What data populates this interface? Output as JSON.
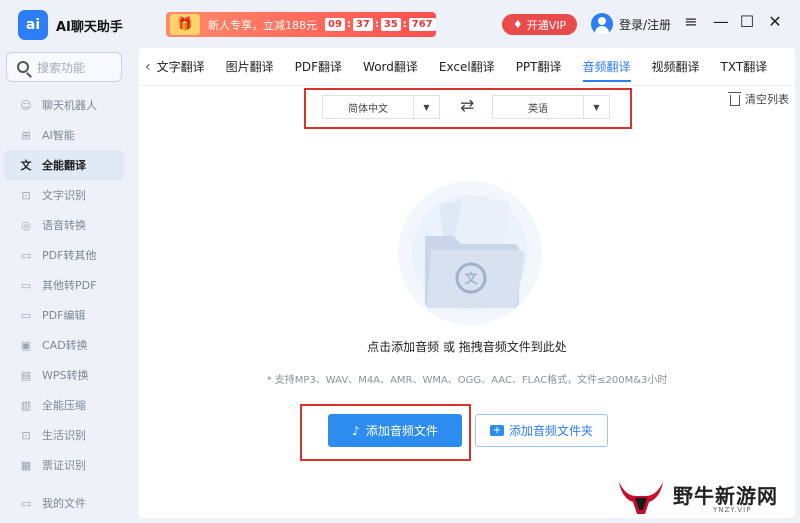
{
  "app": {
    "logo_mark": "ai",
    "title": "AI聊天助手"
  },
  "promo": {
    "text": "新人专享，立减188元",
    "timer": [
      "09",
      "37",
      "35",
      "767"
    ]
  },
  "header": {
    "vip_label": "开通VIP",
    "login_label": "登录/注册"
  },
  "sidebar": {
    "search_placeholder": "搜索功能",
    "items": [
      {
        "label": "聊天机器人",
        "icon": "robot-icon",
        "glyph": "☺"
      },
      {
        "label": "AI智能",
        "icon": "ai-icon",
        "glyph": "⊞"
      },
      {
        "label": "全能翻译",
        "icon": "translate-icon",
        "glyph": "文",
        "active": true
      },
      {
        "label": "文字识别",
        "icon": "text-ocr-icon",
        "glyph": "⊡"
      },
      {
        "label": "语音转换",
        "icon": "voice-icon",
        "glyph": "◎"
      },
      {
        "label": "PDF转其他",
        "icon": "pdf-convert-icon",
        "glyph": "▭"
      },
      {
        "label": "其他转PDF",
        "icon": "to-pdf-icon",
        "glyph": "▭"
      },
      {
        "label": "PDF编辑",
        "icon": "pdf-edit-icon",
        "glyph": "▭"
      },
      {
        "label": "CAD转换",
        "icon": "cad-icon",
        "glyph": "▣"
      },
      {
        "label": "WPS转换",
        "icon": "wps-icon",
        "glyph": "▤"
      },
      {
        "label": "全能压缩",
        "icon": "compress-icon",
        "glyph": "▥"
      },
      {
        "label": "生活识别",
        "icon": "life-scan-icon",
        "glyph": "⊡"
      },
      {
        "label": "票证识别",
        "icon": "ticket-scan-icon",
        "glyph": "▦"
      }
    ],
    "my_files": "我的文件"
  },
  "tabs": [
    {
      "label": "文字翻译"
    },
    {
      "label": "图片翻译"
    },
    {
      "label": "PDF翻译"
    },
    {
      "label": "Word翻译"
    },
    {
      "label": "Excel翻译"
    },
    {
      "label": "PPT翻译"
    },
    {
      "label": "音频翻译",
      "active": true
    },
    {
      "label": "视频翻译"
    },
    {
      "label": "TXT翻译"
    }
  ],
  "language": {
    "source": "简体中文",
    "target": "英语"
  },
  "clear_list": "清空列表",
  "dropzone": {
    "illustration_glyph": "文",
    "hint": "点击添加音频 或 拖拽音频文件到此处",
    "formats": "* 支持MP3、WAV、M4A、AMR、WMA、OGG、AAC、FLAC格式，文件≤200M&3小时"
  },
  "buttons": {
    "add_file": "添加音频文件",
    "add_folder": "添加音频文件夹"
  },
  "watermark": {
    "text": "野牛新游网",
    "sub": "YNZY.VIP"
  },
  "colors": {
    "accent": "#2d7df6",
    "highlight_box": "#d8342a",
    "promo": "#ff4f4f"
  }
}
